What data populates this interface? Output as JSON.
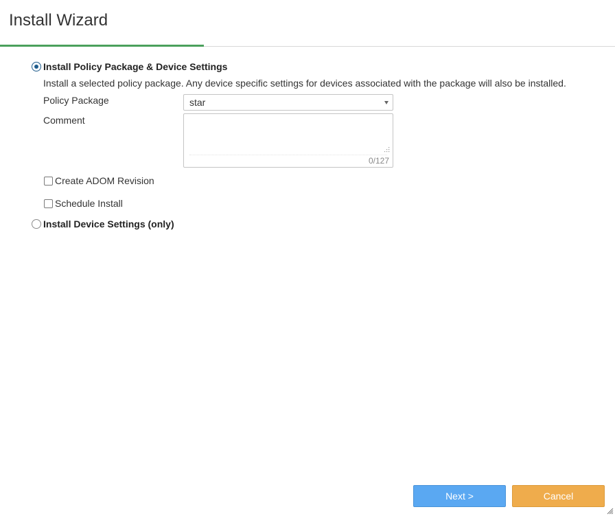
{
  "dialog": {
    "title": "Install Wizard"
  },
  "options": {
    "policy_package": {
      "label": "Install Policy Package & Device Settings",
      "selected": true,
      "description": "Install a selected policy package. Any device specific settings for devices associated with the package will also be installed."
    },
    "device_only": {
      "label": "Install Device Settings (only)",
      "selected": false
    }
  },
  "form": {
    "policy_package_label": "Policy Package",
    "policy_package_value": "star",
    "comment_label": "Comment",
    "comment_value": "",
    "comment_counter": "0/127",
    "create_adom_revision_label": "Create ADOM Revision",
    "schedule_install_label": "Schedule Install"
  },
  "footer": {
    "next_label": "Next >",
    "cancel_label": "Cancel"
  },
  "colors": {
    "progress": "#4aa05c",
    "next_button": "#5aa8f2",
    "cancel_button": "#efac4c",
    "radio_selected": "#1f5c8c"
  },
  "icons": {
    "select_arrow": "chevron-down-icon",
    "textarea_resize": "resize-grip-icon",
    "dialog_resize": "resize-grip-icon"
  }
}
